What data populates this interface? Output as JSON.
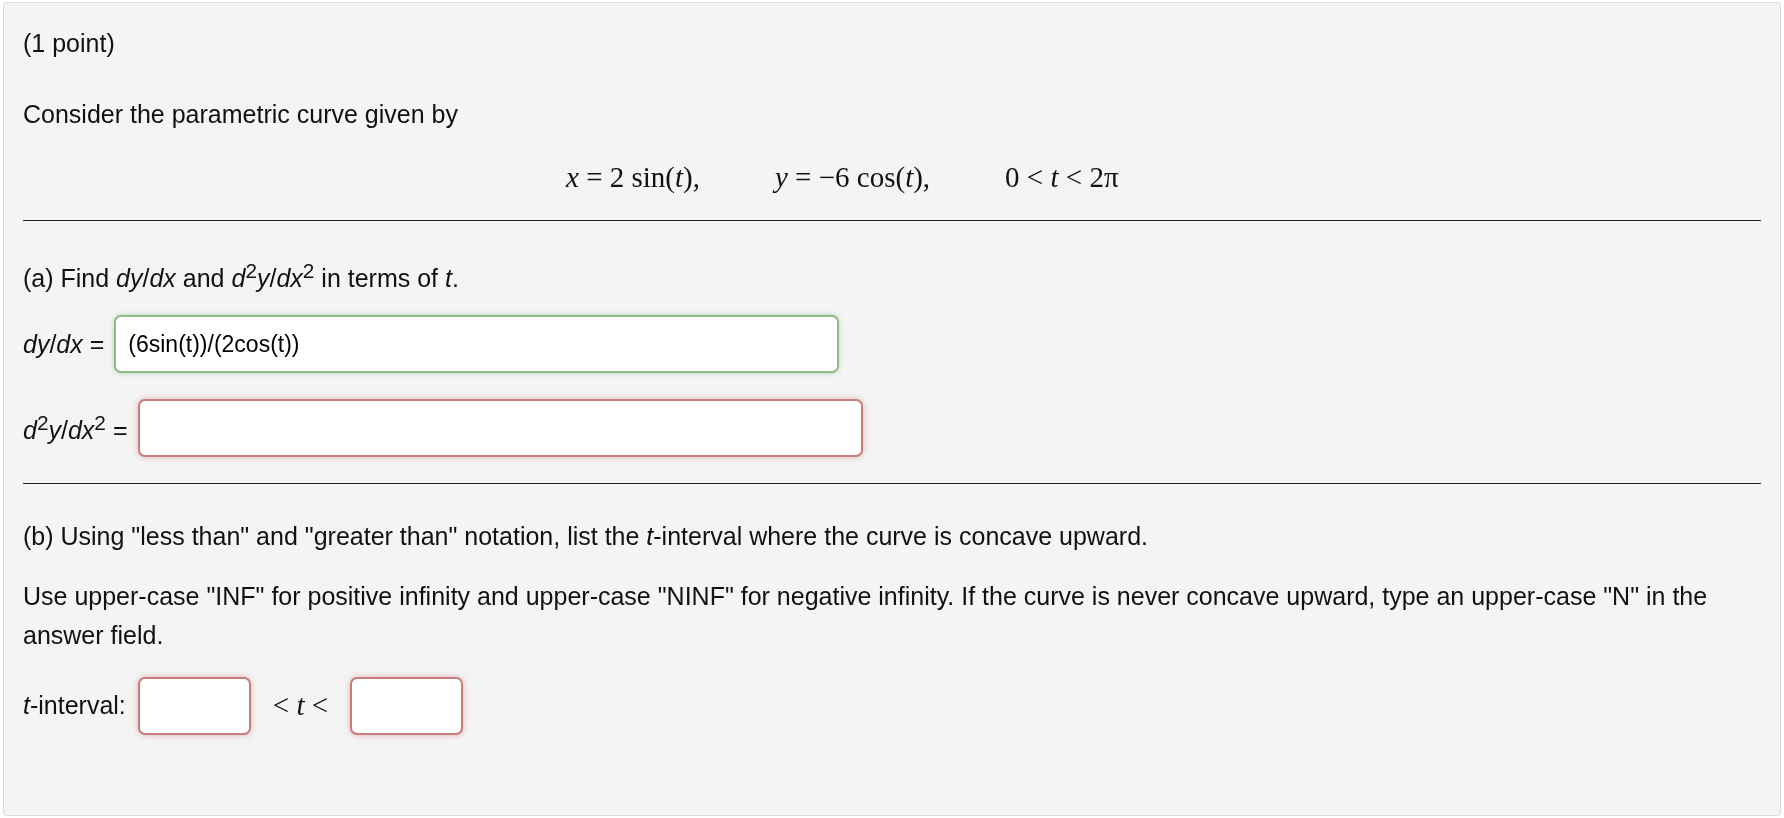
{
  "points": "(1 point)",
  "intro": "Consider the parametric curve given by",
  "equations": [
    "*x* = 2 sin(*t*),",
    "*y* = −6 cos(*t*),",
    "0 < *t* < 2π"
  ],
  "part_a": {
    "prompt": "(a) Find *dy*/*dx* and *d*$^{2}$*y*/*dx*$^{2}$ in terms of *t*.",
    "answers": [
      {
        "label": "*dy*/*dx* =",
        "value": "(6sin(t))/(2cos(t))",
        "correct": true
      },
      {
        "label": "*d*$^{2}$*y*/*dx*$^{2}$ =",
        "correct": false
      }
    ]
  },
  "part_b": {
    "prompt": "(b) Using \"less than\" and \"greater than\" notation, list the *t*-interval where the curve is concave upward.",
    "instructions": "Use upper-case \"INF\" for positive infinity and upper-case \"NINF\" for negative infinity. If the curve is never concave upward, type an upper-case \"N\" in the answer field.",
    "interval_label": "*t*-interval:",
    "lower": {
      "correct": false
    },
    "between": "< *t* <",
    "upper": {
      "correct": false
    }
  }
}
